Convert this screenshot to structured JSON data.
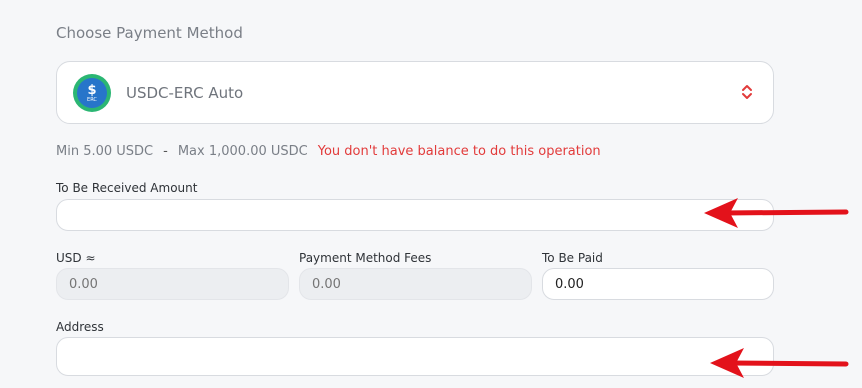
{
  "payment": {
    "section_title": "Choose Payment Method",
    "selected_method": "USDC-ERC Auto",
    "coin_symbol": "$",
    "coin_tag": "ERC"
  },
  "limits": {
    "min": "Min 5.00 USDC",
    "separator": "-",
    "max": "Max 1,000.00 USDC",
    "error": "You don't have balance to do this operation"
  },
  "form": {
    "received_label": "To Be Received Amount",
    "received_value": "",
    "usd_label": "USD ≈",
    "usd_placeholder": "0.00",
    "fees_label": "Payment Method Fees",
    "fees_placeholder": "0.00",
    "paid_label": "To Be Paid",
    "paid_value": "0.00",
    "address_label": "Address",
    "address_value": ""
  },
  "colors": {
    "error": "#e23b3b",
    "arrow": "#e3121b",
    "coin_outer": "#2bb673",
    "coin_inner": "#2775ca"
  }
}
